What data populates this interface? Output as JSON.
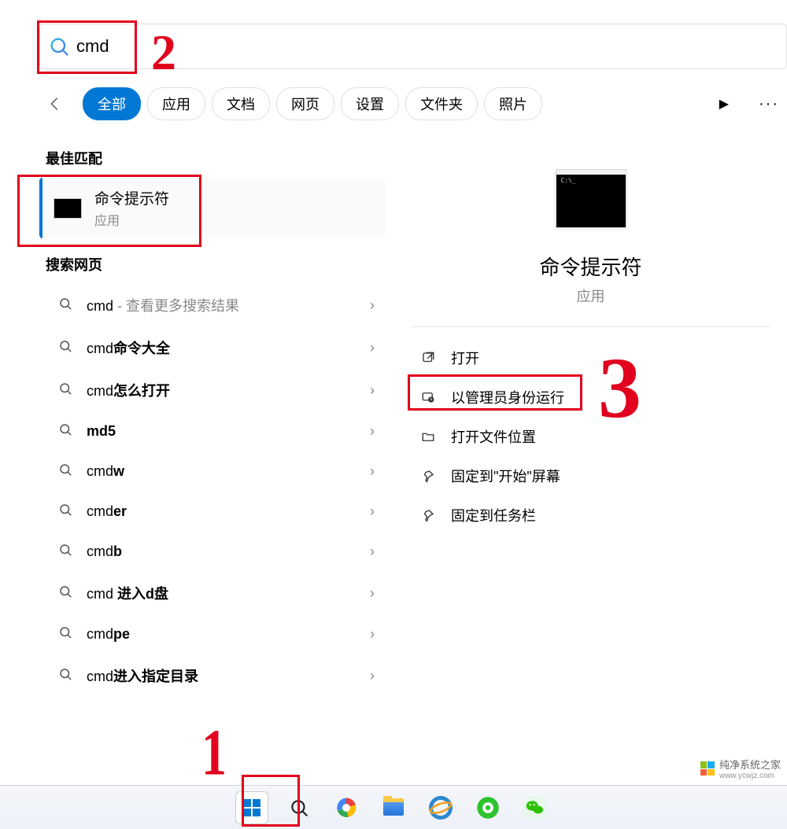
{
  "search": {
    "value": "cmd"
  },
  "tabs": [
    "全部",
    "应用",
    "文档",
    "网页",
    "设置",
    "文件夹",
    "照片"
  ],
  "active_tab_index": 0,
  "left": {
    "best_match_header": "最佳匹配",
    "best_match": {
      "title": "命令提示符",
      "subtitle": "应用"
    },
    "search_web_header": "搜索网页",
    "items": [
      {
        "prefix": "cmd",
        "bold": "",
        "hint": " - 查看更多搜索结果"
      },
      {
        "prefix": "cmd",
        "bold": "命令大全",
        "hint": ""
      },
      {
        "prefix": "cmd",
        "bold": "怎么打开",
        "hint": ""
      },
      {
        "prefix": "",
        "bold": "md5",
        "hint": ""
      },
      {
        "prefix": "cmd",
        "bold": "w",
        "hint": ""
      },
      {
        "prefix": "cmd",
        "bold": "er",
        "hint": ""
      },
      {
        "prefix": "cmd",
        "bold": "b",
        "hint": ""
      },
      {
        "prefix": "cmd ",
        "bold": "进入d盘",
        "hint": ""
      },
      {
        "prefix": "cmd",
        "bold": "pe",
        "hint": ""
      },
      {
        "prefix": "cmd",
        "bold": "进入指定目录",
        "hint": ""
      }
    ]
  },
  "right": {
    "title": "命令提示符",
    "subtitle": "应用",
    "actions": [
      {
        "icon": "open",
        "label": "打开"
      },
      {
        "icon": "admin",
        "label": "以管理员身份运行"
      },
      {
        "icon": "folder",
        "label": "打开文件位置"
      },
      {
        "icon": "pin",
        "label": "固定到\"开始\"屏幕"
      },
      {
        "icon": "pin",
        "label": "固定到任务栏"
      }
    ]
  },
  "annotations": {
    "n1": "1",
    "n2": "2",
    "n3": "3"
  },
  "watermark": {
    "title": "纯净系统之家",
    "url": "www.ycwjz.com"
  }
}
